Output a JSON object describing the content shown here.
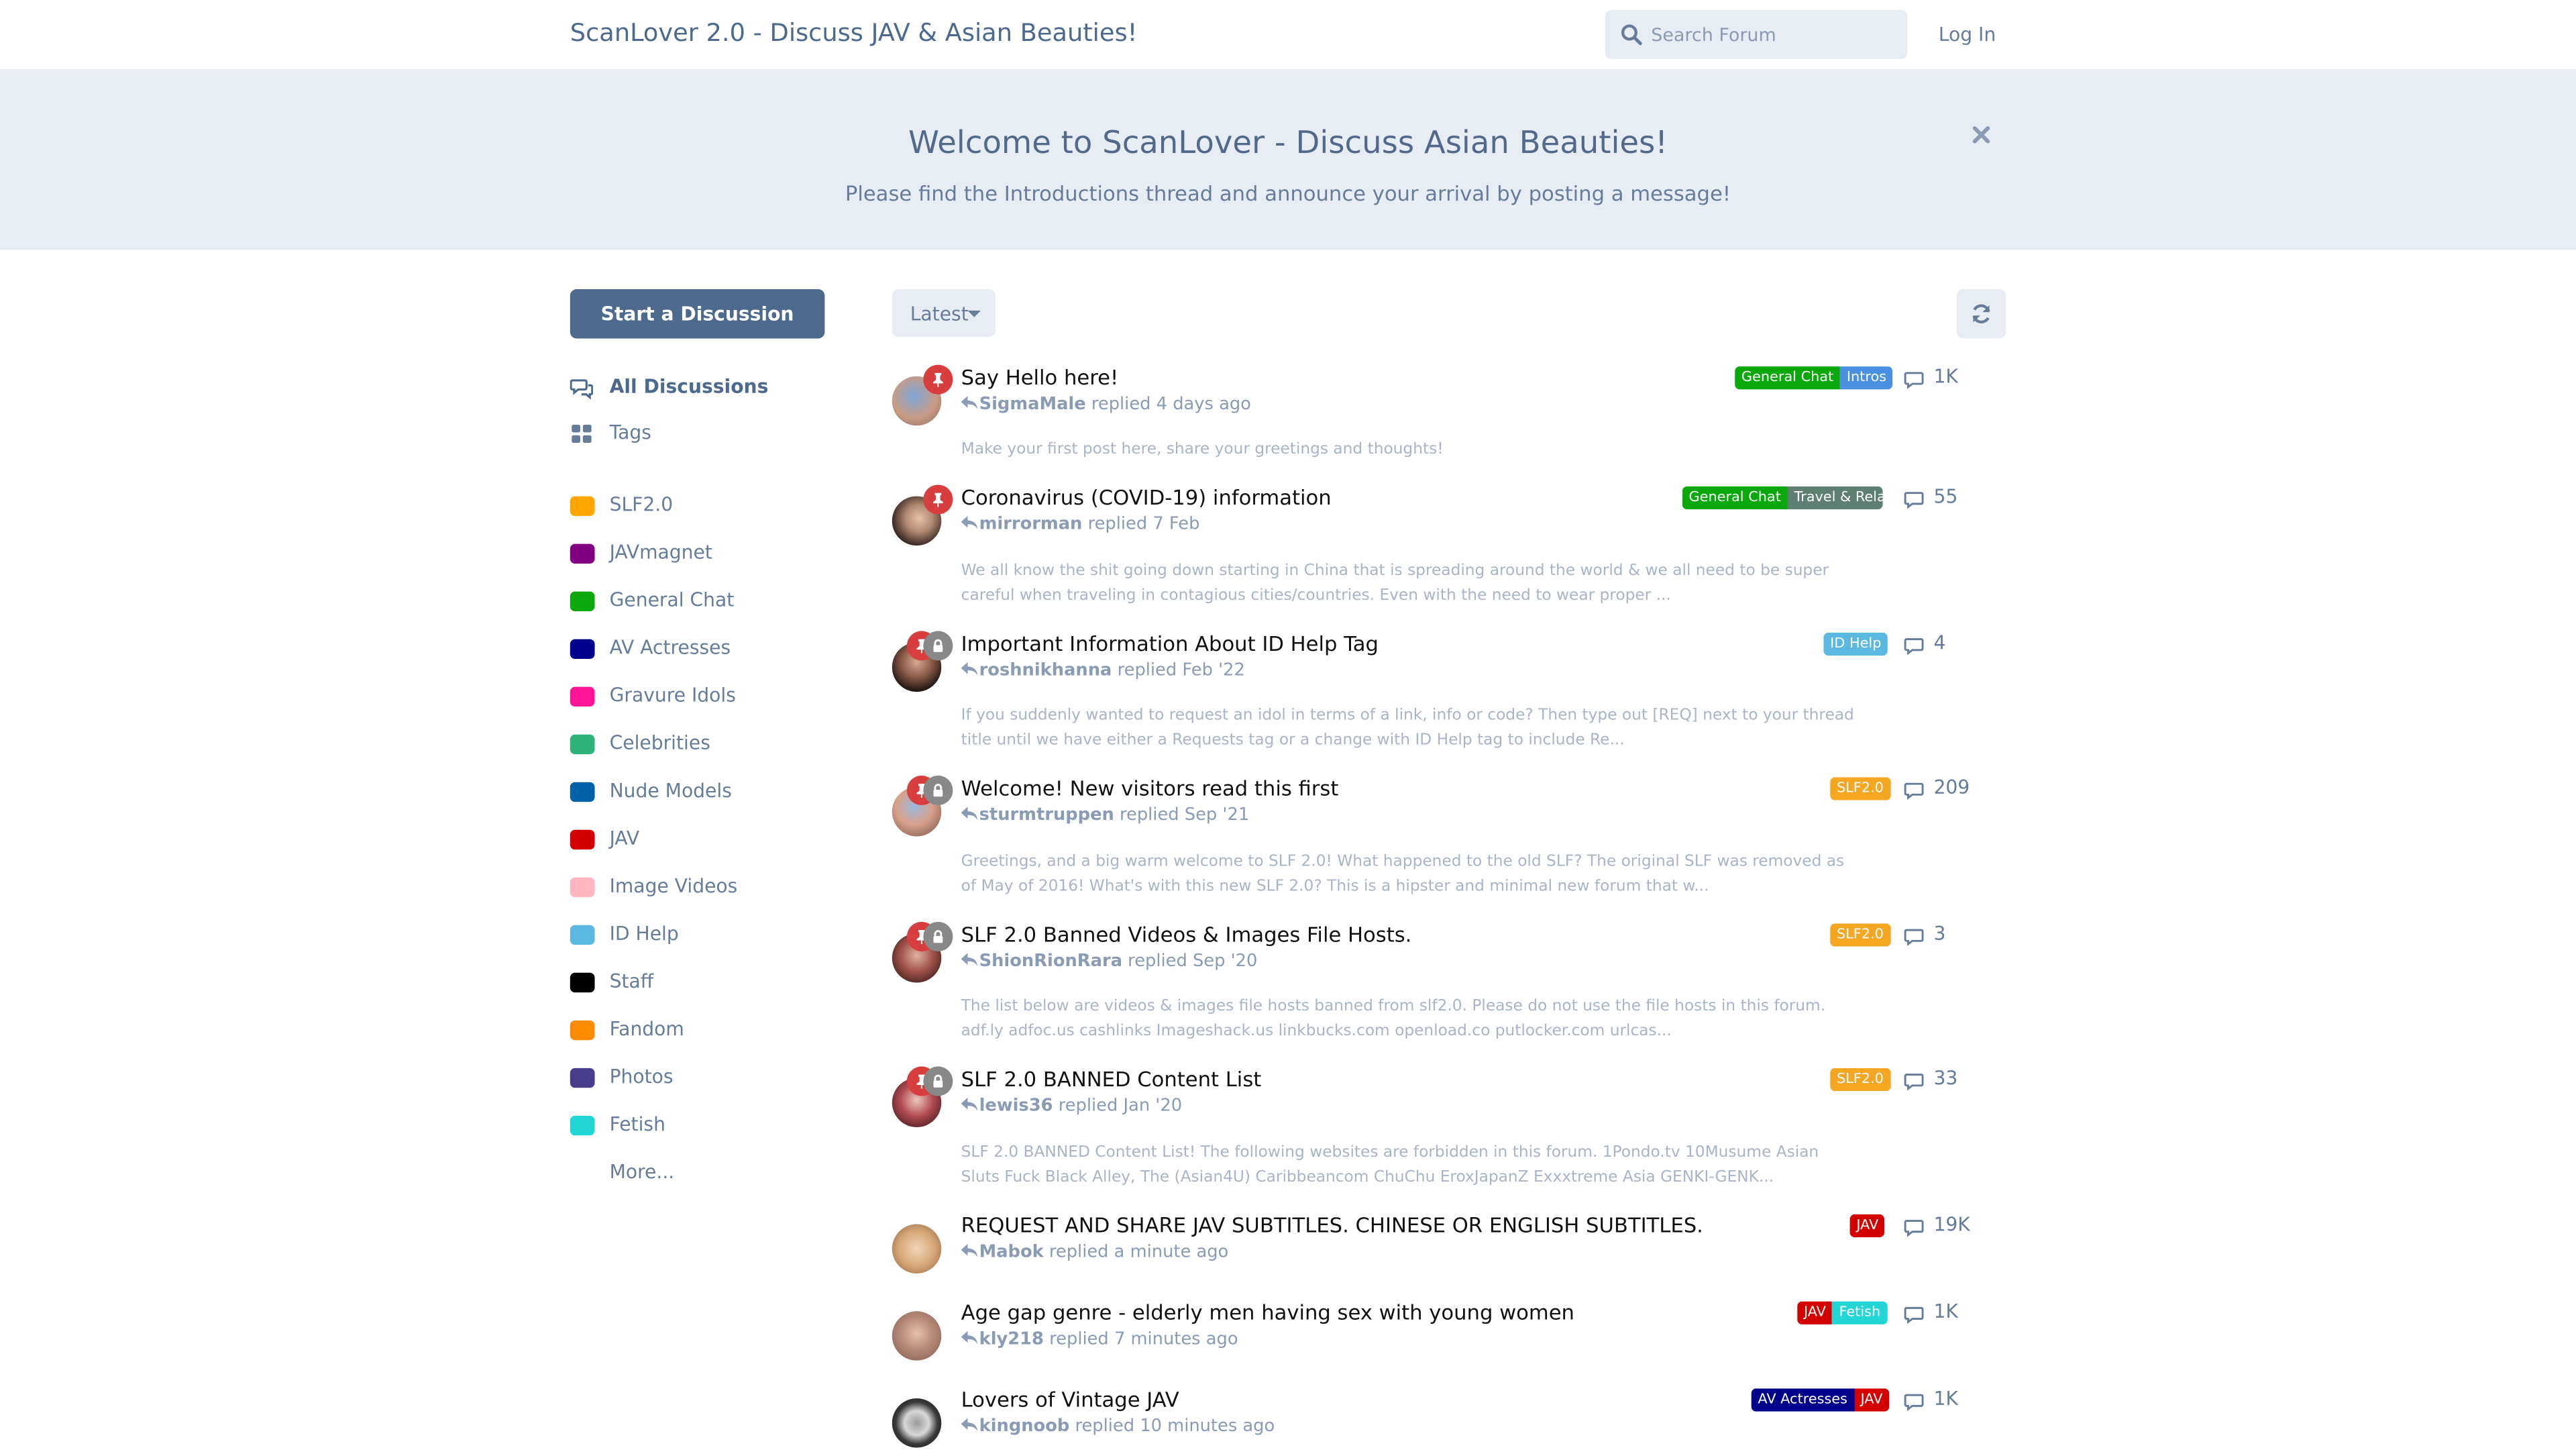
{
  "header": {
    "site_title": "ScanLover 2.0 - Discuss JAV & Asian Beauties!",
    "search_placeholder": "Search Forum",
    "login_label": "Log In"
  },
  "hero": {
    "title": "Welcome to ScanLover - Discuss Asian Beauties!",
    "subtitle": "Please find the Introductions thread and announce your arrival by posting a message!",
    "close_icon": "close-icon"
  },
  "sidebar": {
    "start_label": "Start a Discussion",
    "nav": [
      {
        "label": "All Discussions",
        "icon": "comments-icon",
        "active": true
      },
      {
        "label": "Tags",
        "icon": "tags-grid-icon",
        "active": false
      }
    ],
    "tags": [
      {
        "label": "SLF2.0",
        "color": "#ffa500"
      },
      {
        "label": "JAVmagnet",
        "color": "#800080"
      },
      {
        "label": "General Chat",
        "color": "#0aa80a"
      },
      {
        "label": "AV Actresses",
        "color": "#00008b"
      },
      {
        "label": "Gravure Idols",
        "color": "#ff1493"
      },
      {
        "label": "Celebrities",
        "color": "#2db37a"
      },
      {
        "label": "Nude Models",
        "color": "#0060a8"
      },
      {
        "label": "JAV",
        "color": "#d40000"
      },
      {
        "label": "Image Videos",
        "color": "#ffb6c1"
      },
      {
        "label": "ID Help",
        "color": "#5bb8e0"
      },
      {
        "label": "Staff",
        "color": "#000000"
      },
      {
        "label": "Fandom",
        "color": "#ff8c00"
      },
      {
        "label": "Photos",
        "color": "#483d8b"
      },
      {
        "label": "Fetish",
        "color": "#22d6d6"
      }
    ],
    "more_label": "More..."
  },
  "toolbar": {
    "sort_label": "Latest",
    "refresh_icon": "refresh-icon"
  },
  "discussions": [
    {
      "title": "Say Hello here!",
      "user": "SigmaMale",
      "action": "replied",
      "time": "4 days ago",
      "excerpt": "Make your first post here, share your greetings and thoughts!",
      "tags": [
        {
          "label": "General Chat",
          "color": "#0aa80a"
        },
        {
          "label": "Intros",
          "color": "#4a90e2"
        }
      ],
      "count": "1K",
      "pinned": true,
      "locked": false
    },
    {
      "title": "Coronavirus (COVID-19) information",
      "user": "mirrorman",
      "action": "replied",
      "time": "7 Feb",
      "excerpt": "We all know the shit going down starting in China that is spreading around the world & we all need to be super careful when traveling in contagious cities/countries. Even with the need to wear proper ...",
      "tags": [
        {
          "label": "General Chat",
          "color": "#0aa80a"
        },
        {
          "label": "Travel & Relat",
          "color": "#5f7f72"
        }
      ],
      "count": "55",
      "pinned": true,
      "locked": false
    },
    {
      "title": "Important Information About ID Help Tag",
      "user": "roshnikhanna",
      "action": "replied",
      "time": "Feb '22",
      "excerpt": "If you suddenly wanted to request an idol in terms of a link, info or code? Then type out [REQ] next to your thread title until we have either a Requests tag or a change with ID Help tag to include Re...",
      "tags": [
        {
          "label": "ID Help",
          "color": "#5bb8e0"
        }
      ],
      "count": "4",
      "pinned": true,
      "locked": true
    },
    {
      "title": "Welcome! New visitors read this first",
      "user": "sturmtruppen",
      "action": "replied",
      "time": "Sep '21",
      "excerpt": "Greetings, and a big warm welcome to SLF 2.0! What happened to the old SLF? The original SLF was removed as of May of 2016! What's with this new SLF 2.0? This is a hipster and minimal new forum that w...",
      "tags": [
        {
          "label": "SLF2.0",
          "color": "#f5a623"
        }
      ],
      "count": "209",
      "pinned": true,
      "locked": true
    },
    {
      "title": "SLF 2.0 Banned Videos & Images File Hosts.",
      "user": "ShionRionRara",
      "action": "replied",
      "time": "Sep '20",
      "excerpt": "The list below are videos & images file hosts banned from slf2.0. Please do not use the file hosts in this forum. adf.ly adfoc.us cashlinks Imageshack.us linkbucks.com openload.co putlocker.com urlcas...",
      "tags": [
        {
          "label": "SLF2.0",
          "color": "#f5a623"
        }
      ],
      "count": "3",
      "pinned": true,
      "locked": true
    },
    {
      "title": "SLF 2.0 BANNED Content List",
      "user": "lewis36",
      "action": "replied",
      "time": "Jan '20",
      "excerpt": "SLF 2.0 BANNED Content List! The following websites are forbidden in this forum. 1Pondo.tv 10Musume Asian Sluts Fuck Black Alley, The (Asian4U) Caribbeancom ChuChu EroxJapanZ Exxxtreme Asia GENKI-GENK...",
      "tags": [
        {
          "label": "SLF2.0",
          "color": "#f5a623"
        }
      ],
      "count": "33",
      "pinned": true,
      "locked": true
    },
    {
      "title": "REQUEST AND SHARE JAV SUBTITLES. CHINESE OR ENGLISH SUBTITLES.",
      "user": "Mabok",
      "action": "replied",
      "time": "a minute ago",
      "excerpt": "",
      "tags": [
        {
          "label": "JAV",
          "color": "#d40000"
        }
      ],
      "count": "19K",
      "pinned": false,
      "locked": false
    },
    {
      "title": "Age gap genre - elderly men having sex with young women",
      "user": "kly218",
      "action": "replied",
      "time": "7 minutes ago",
      "excerpt": "",
      "tags": [
        {
          "label": "JAV",
          "color": "#d40000"
        },
        {
          "label": "Fetish",
          "color": "#22d6d6"
        }
      ],
      "count": "1K",
      "pinned": false,
      "locked": false
    },
    {
      "title": "Lovers of Vintage JAV",
      "user": "kingnoob",
      "action": "replied",
      "time": "10 minutes ago",
      "excerpt": "",
      "tags": [
        {
          "label": "AV Actresses",
          "color": "#00008b"
        },
        {
          "label": "JAV",
          "color": "#d40000"
        }
      ],
      "count": "1K",
      "pinned": false,
      "locked": false
    }
  ]
}
